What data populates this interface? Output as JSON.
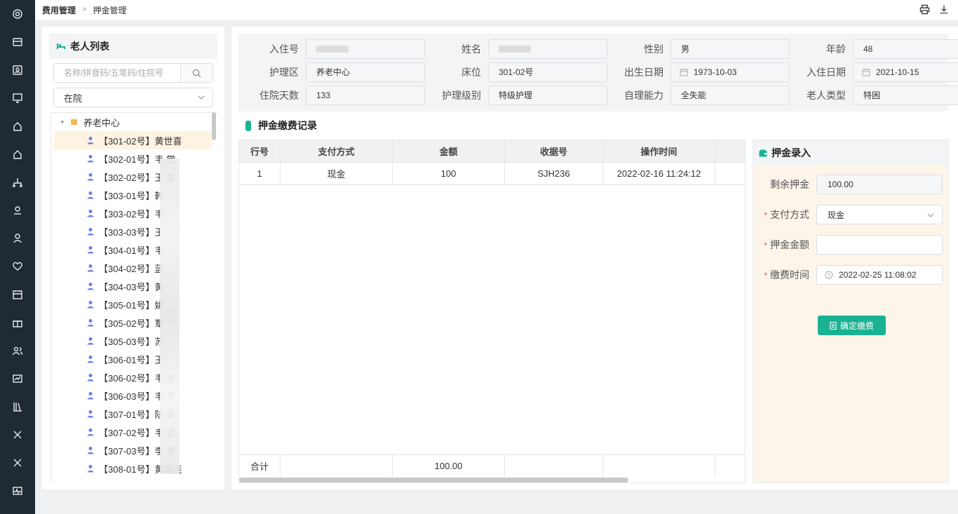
{
  "breadcrumb": {
    "section": "费用管理",
    "page": "押金管理"
  },
  "rail_icons": [
    "gear-icon",
    "card-icon",
    "id-card-icon",
    "monitor-icon",
    "home-icon",
    "home-icon",
    "network-icon",
    "bed-icon",
    "user-badge-icon",
    "hand-heart-icon",
    "calendar-icon",
    "gift-icon",
    "users-icon",
    "chart-icon",
    "library-icon",
    "tools-icon",
    "tools-icon",
    "pulse-icon"
  ],
  "left": {
    "title": "老人列表",
    "search_placeholder": "名称/拼音码/五笔码/住院号",
    "filter_value": "在院",
    "tree_root": "养老中心",
    "residents": [
      "【301-02号】黄世喜",
      "【302-01号】韦 堂",
      "【302-02号】王 庭",
      "【303-01号】韩 ",
      "【303-02号】韦 ",
      "【303-03号】王 ",
      "【304-01号】韦 ",
      "【304-02号】蓝 ",
      "【304-03号】黄 ",
      "【305-01号】姚 ",
      "【305-02号】覃 ",
      "【305-03号】苏 ",
      "【306-01号】王 ",
      "【306-02号】韦 才",
      "【306-03号】韦 年",
      "【307-01号】陆 英",
      "【307-02号】韦 武",
      "【307-03号】李 家",
      "【308-01号】黄瑞连"
    ],
    "selected_index": 0
  },
  "info": {
    "admission_no_label": "入住号",
    "name_label": "姓名",
    "gender_label": "性别",
    "gender": "男",
    "age_label": "年龄",
    "age": "48",
    "care_area_label": "护理区",
    "care_area": "养老中心",
    "bed_label": "床位",
    "bed": "301-02号",
    "birth_label": "出生日期",
    "birth": "1973-10-03",
    "checkin_label": "入住日期",
    "checkin": "2021-10-15",
    "days_label": "住院天数",
    "days": "133",
    "care_level_label": "护理级别",
    "care_level": "特级护理",
    "self_care_label": "自理能力",
    "self_care": "全失能",
    "elder_type_label": "老人类型",
    "elder_type": "特困"
  },
  "records": {
    "title": "押金缴费记录",
    "columns": [
      "行号",
      "支付方式",
      "金额",
      "收据号",
      "操作时间"
    ],
    "rows": [
      [
        "1",
        "现金",
        "100",
        "SJH236",
        "2022-02-16 11:24:12"
      ]
    ],
    "total_label": "合计",
    "total_amount": "100.00"
  },
  "entry": {
    "title": "押金录入",
    "balance_label": "剩余押金",
    "balance": "100.00",
    "method_label": "支付方式",
    "method": "现金",
    "amount_label": "押金金额",
    "amount": "",
    "time_label": "缴费时间",
    "time": "2022-02-25 11:08:02",
    "confirm_label": "确定缴费"
  },
  "colors": {
    "accent": "#19b394",
    "rail": "#1e2a34",
    "selected_row": "#fdf3e0",
    "entry_bg": "#fdf5ea"
  }
}
